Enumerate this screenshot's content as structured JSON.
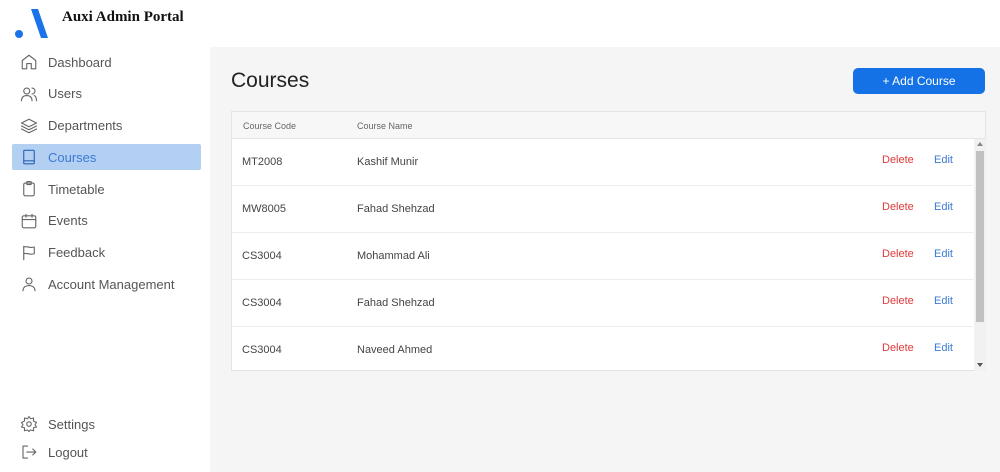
{
  "app": {
    "title": "Auxi Admin Portal"
  },
  "sidebar": {
    "items": [
      {
        "label": "Dashboard",
        "icon": "home-icon"
      },
      {
        "label": "Users",
        "icon": "users-icon"
      },
      {
        "label": "Departments",
        "icon": "layers-icon"
      },
      {
        "label": "Courses",
        "icon": "book-icon",
        "active": true
      },
      {
        "label": "Timetable",
        "icon": "clipboard-icon"
      },
      {
        "label": "Events",
        "icon": "calendar-icon"
      },
      {
        "label": "Feedback",
        "icon": "flag-icon"
      },
      {
        "label": "Account Management",
        "icon": "user-icon"
      }
    ],
    "bottom": [
      {
        "label": "Settings",
        "icon": "gear-icon"
      },
      {
        "label": "Logout",
        "icon": "logout-icon"
      }
    ]
  },
  "main": {
    "title": "Courses",
    "add_button": "+ Add Course",
    "table": {
      "headers": {
        "code": "Course Code",
        "name": "Course Name"
      },
      "rows": [
        {
          "code": "MT2008",
          "name": "Kashif Munir",
          "delete": "Delete",
          "edit": "Edit"
        },
        {
          "code": "MW8005",
          "name": "Fahad Shehzad",
          "delete": "Delete",
          "edit": "Edit"
        },
        {
          "code": "CS3004",
          "name": "Mohammad Ali",
          "delete": "Delete",
          "edit": "Edit"
        },
        {
          "code": "CS3004",
          "name": "Fahad Shehzad",
          "delete": "Delete",
          "edit": "Edit"
        },
        {
          "code": "CS3004",
          "name": "Naveed Ahmed",
          "delete": "Delete",
          "edit": "Edit"
        }
      ]
    }
  },
  "colors": {
    "accent": "#1472e6",
    "active_bg": "#b3cff2",
    "delete": "#e03a3a",
    "edit": "#3b7bd4"
  }
}
